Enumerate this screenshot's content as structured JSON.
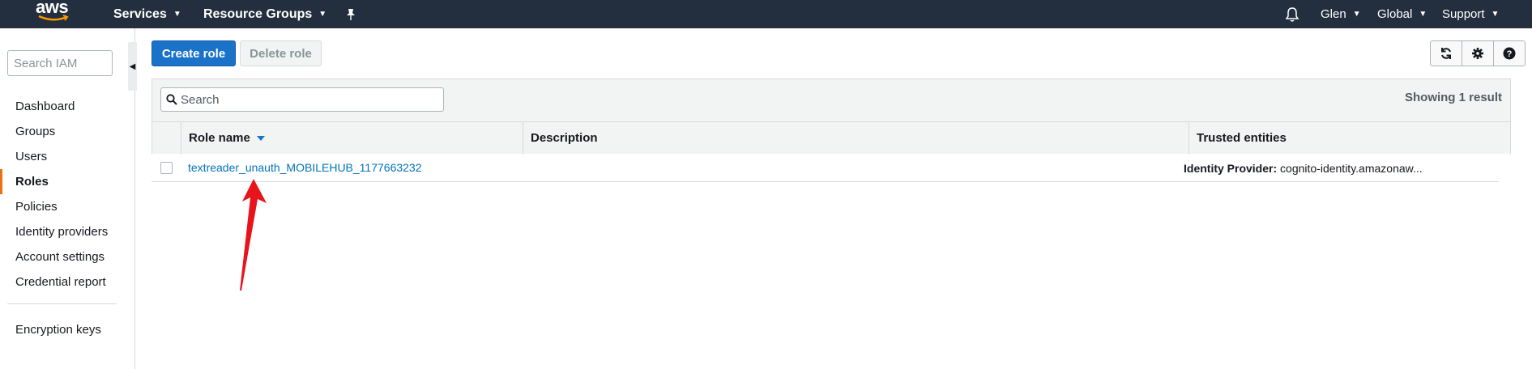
{
  "topnav": {
    "logo": "aws",
    "services": "Services",
    "resource_groups": "Resource Groups",
    "user": "Glen",
    "region": "Global",
    "support": "Support"
  },
  "sidebar": {
    "search_placeholder": "Search IAM",
    "items": [
      {
        "label": "Dashboard",
        "active": false
      },
      {
        "label": "Groups",
        "active": false
      },
      {
        "label": "Users",
        "active": false
      },
      {
        "label": "Roles",
        "active": true
      },
      {
        "label": "Policies",
        "active": false
      },
      {
        "label": "Identity providers",
        "active": false
      },
      {
        "label": "Account settings",
        "active": false
      },
      {
        "label": "Credential report",
        "active": false
      }
    ],
    "extra_item": "Encryption keys"
  },
  "toolbar": {
    "create_role": "Create role",
    "delete_role": "Delete role"
  },
  "table": {
    "search_placeholder": "Search",
    "showing": "Showing 1 result",
    "columns": [
      "Role name",
      "Description",
      "Trusted entities"
    ],
    "rows": [
      {
        "role_name": "textreader_unauth_MOBILEHUB_1177663232",
        "description": "",
        "trusted_label": "Identity Provider:",
        "trusted_value": "cognito-identity.amazonaw..."
      }
    ]
  },
  "colors": {
    "nav_bg": "#232f3e",
    "primary": "#1a73c8",
    "link": "#0073bb",
    "active_accent": "#ec7211",
    "annotation": "#e8141b"
  }
}
